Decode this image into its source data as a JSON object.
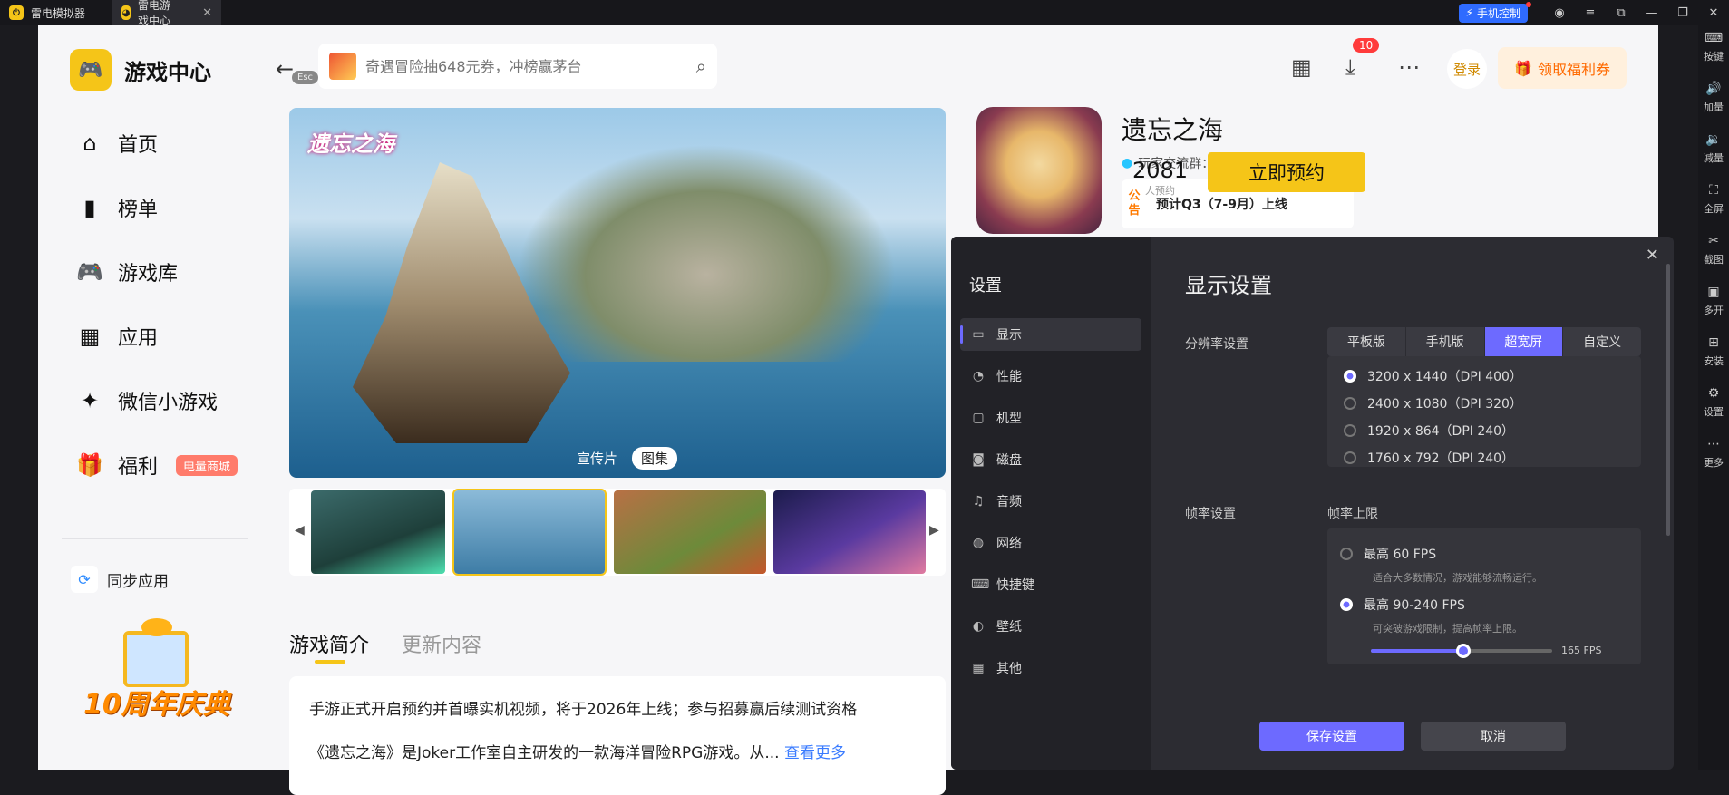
{
  "titlebar": {
    "tabs": [
      {
        "label": "雷电模拟器"
      },
      {
        "label": "雷电游戏中心"
      }
    ],
    "phone_control": "手机控制"
  },
  "rightbar": {
    "items": [
      {
        "label": "按键",
        "icon": "keyboard-icon"
      },
      {
        "label": "加量",
        "icon": "volume-up-icon"
      },
      {
        "label": "减量",
        "icon": "volume-down-icon"
      },
      {
        "label": "全屏",
        "icon": "fullscreen-icon"
      },
      {
        "label": "截图",
        "icon": "scissors-icon"
      },
      {
        "label": "多开",
        "icon": "multi-instance-icon"
      },
      {
        "label": "安装",
        "icon": "install-icon"
      },
      {
        "label": "设置",
        "icon": "settings-icon"
      },
      {
        "label": "更多",
        "icon": "more-icon"
      }
    ]
  },
  "sidebar": {
    "brand": "游戏中心",
    "items": [
      {
        "label": "首页"
      },
      {
        "label": "榜单"
      },
      {
        "label": "游戏库"
      },
      {
        "label": "应用"
      },
      {
        "label": "微信小游戏"
      },
      {
        "label": "福利",
        "badge": "电量商城"
      }
    ],
    "sync": "同步应用",
    "anniversary": "10周年庆典"
  },
  "topbar": {
    "esc": "Esc",
    "search_placeholder": "奇遇冒险抽648元券，冲榜赢茅台",
    "download_count": "10",
    "login": "登录",
    "welfare": "领取福利券"
  },
  "hero": {
    "logo": "遗忘之海",
    "tabs": [
      "宣传片",
      "图集"
    ],
    "active_tab": "图集"
  },
  "description": {
    "tabs": [
      "游戏简介",
      "更新内容"
    ],
    "line1": "手游正式开启预约并首曝实机视频，将于2026年上线；参与招募赢后续测试资格",
    "line2": "《遗忘之海》是Joker工作室自主研发的一款海洋冒险RPG游戏。从...",
    "more": "查看更多"
  },
  "game": {
    "title": "遗忘之海",
    "group": "玩家交流群：772562172",
    "notice_tag": "公告",
    "notice": "预计Q3（7-9月）上线",
    "reserve_count": "2081",
    "reserve_label": "人预约",
    "reserve_button": "立即预约"
  },
  "settings": {
    "title": "设置",
    "menu": [
      {
        "label": "显示",
        "icon": "monitor-icon"
      },
      {
        "label": "性能",
        "icon": "performance-icon"
      },
      {
        "label": "机型",
        "icon": "device-icon"
      },
      {
        "label": "磁盘",
        "icon": "disk-icon"
      },
      {
        "label": "音频",
        "icon": "audio-icon"
      },
      {
        "label": "网络",
        "icon": "globe-icon"
      },
      {
        "label": "快捷键",
        "icon": "keyboard-icon"
      },
      {
        "label": "壁纸",
        "icon": "palette-icon"
      },
      {
        "label": "其他",
        "icon": "grid-icon"
      }
    ],
    "heading": "显示设置",
    "resolution_label": "分辨率设置",
    "resolution_tabs": [
      "平板版",
      "手机版",
      "超宽屏",
      "自定义"
    ],
    "resolution_active": "超宽屏",
    "resolutions": [
      "3200 x 1440（DPI 400）",
      "2400 x 1080（DPI 320）",
      "1920 x 864（DPI 240）",
      "1760 x 792（DPI 240）"
    ],
    "selected_resolution": "3200 x 1440（DPI 400）",
    "framerate_label": "帧率设置",
    "framerate_cap_label": "帧率上限",
    "fps_options": [
      {
        "label": "最高 60 FPS",
        "desc": "适合大多数情况，游戏能够流畅运行。"
      },
      {
        "label": "最高 90-240 FPS",
        "desc": "可突破游戏限制，提高帧率上限。"
      }
    ],
    "selected_fps_option": "最高 90-240 FPS",
    "fps_value": "165 FPS",
    "fps_slider_fraction": 0.51,
    "save": "保存设置",
    "cancel": "取消"
  },
  "colors": {
    "accent": "#f5c518",
    "dialog_accent": "#6d6aff",
    "link": "#3a7bff"
  }
}
